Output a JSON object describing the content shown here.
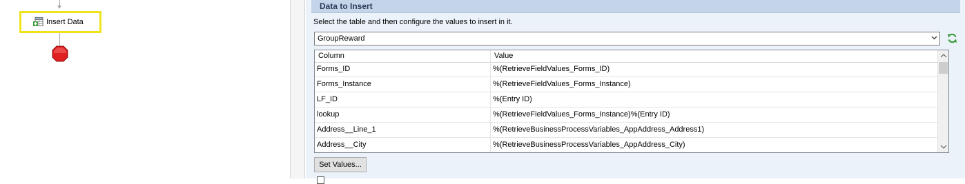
{
  "workflow": {
    "activity_label": "Insert Data",
    "icons": {
      "activity": "insert-data-icon",
      "end": "end-stop-octagon-icon"
    },
    "highlight_color": "#f0e31b"
  },
  "properties": {
    "section_title": "Data to Insert",
    "instruction": "Select the table and then configure the values to insert in it.",
    "table_select": {
      "value": "GroupReward",
      "icon": "chevron-down-icon"
    },
    "refresh_icon": "refresh-icon",
    "grid": {
      "columns": [
        "Column",
        "Value"
      ],
      "rows": [
        {
          "column": "Forms_ID",
          "value": "%(RetrieveFieldValues_Forms_ID)"
        },
        {
          "column": "Forms_Instance",
          "value": "%(RetrieveFieldValues_Forms_Instance)"
        },
        {
          "column": "LF_ID",
          "value": "%(Entry ID)"
        },
        {
          "column": "lookup",
          "value": "%(RetrieveFieldValues_Forms_Instance)%(Entry ID)"
        },
        {
          "column": "Address__Line_1",
          "value": "%(RetrieveBusinessProcessVariables_AppAddress_Address1)"
        },
        {
          "column": "Address__City",
          "value": "%(RetrieveBusinessProcessVariables_AppAddress_City)"
        }
      ]
    },
    "set_values_label": "Set Values...",
    "colors": {
      "pane_background": "#ecf2fa",
      "header_background": "#c4d4e9",
      "header_text": "#2c3e5a"
    }
  }
}
